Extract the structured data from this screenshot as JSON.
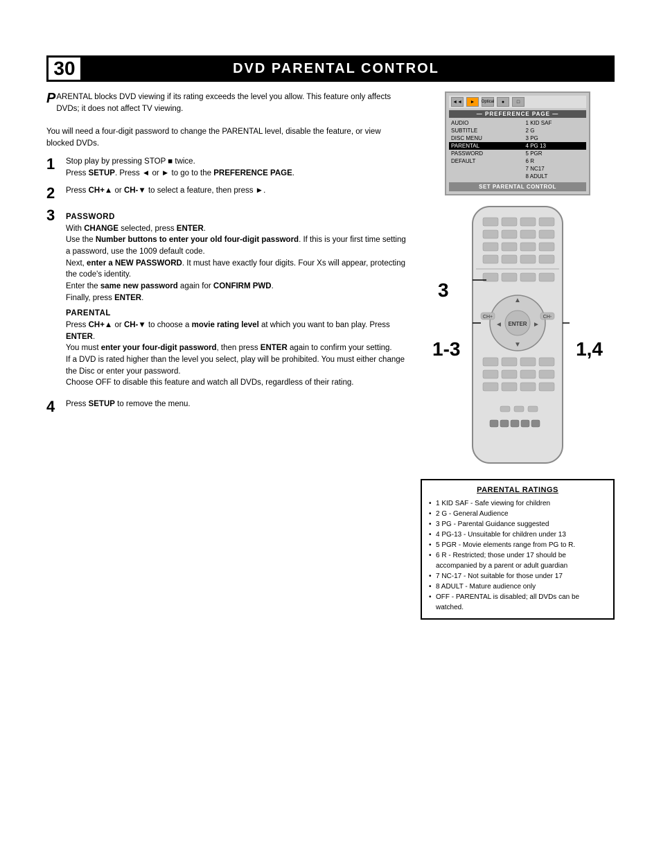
{
  "header": {
    "page_number": "30",
    "title": "DVD Parental Control"
  },
  "intro": {
    "drop_letter": "P",
    "text": "ARENTAL blocks DVD viewing if its rating exceeds the level you allow. This feature only affects DVDs; it does not affect TV viewing.",
    "note": "You will need a four-digit password to change the PARENTAL level, disable the feature, or view blocked DVDs."
  },
  "steps": [
    {
      "number": "1",
      "lines": [
        "Stop play by pressing STOP ■ twice.",
        "Press SETUP. Press ◄ or ► to go to the PREFERENCE PAGE."
      ]
    },
    {
      "number": "2",
      "lines": [
        "Press CH+▲ or CH-▼ to select a feature, then press ►."
      ]
    },
    {
      "number": "3",
      "sub_title": "PASSWORD",
      "lines": [
        "With CHANGE selected, press ENTER.",
        "Use the Number buttons to enter your old four-digit password. If this is your first time setting a password, use the 1009 default code.",
        "Next, enter a NEW PASSWORD. It must have exactly four digits. Four Xs will appear, protecting the code's identity.",
        "Enter the same new password again for CONFIRM PWD.",
        "Finally, press ENTER."
      ],
      "parental_sub": {
        "title": "PARENTAL",
        "lines": [
          "Press CH+▲ or CH-▼ to choose a movie rating level at which you want to ban play. Press ENTER.",
          "You must enter your four-digit password, then press ENTER again to confirm your setting.",
          "If a DVD is rated higher than the level you select, play will be prohibited. You must either change the Disc or enter your password.",
          "Choose OFF to disable this feature and watch all DVDs, regardless of their rating."
        ]
      }
    },
    {
      "number": "4",
      "lines": [
        "Press SETUP to remove the menu."
      ]
    }
  ],
  "tv_screen": {
    "pref_page_label": "— PREFERENCE PAGE —",
    "rows": [
      {
        "label": "AUDIO",
        "value": "1 KID SAF",
        "highlighted": false
      },
      {
        "label": "SUBTITLE",
        "value": "2 G",
        "highlighted": false
      },
      {
        "label": "DISC MENU",
        "value": "3 PG",
        "highlighted": false
      },
      {
        "label": "PARENTAL",
        "value": "4 PG 13",
        "highlighted": true
      },
      {
        "label": "PASSWORD",
        "value": "5 PGR",
        "highlighted": false
      },
      {
        "label": "DEFAULT",
        "value": "6 R",
        "highlighted": false
      },
      {
        "label": "",
        "value": "7 NC17",
        "highlighted": false
      },
      {
        "label": "",
        "value": "8 ADULT",
        "highlighted": false
      }
    ],
    "set_button": "SET PARENTAL CONTROL"
  },
  "step_labels": {
    "label_3": "3",
    "label_13": "1-3",
    "label_14": "1,4"
  },
  "ratings_box": {
    "title": "Parental Ratings",
    "items": [
      "1 KID SAF - Safe viewing for children",
      "2 G - General Audience",
      "3 PG - Parental Guidance suggested",
      "4 PG-13 - Unsuitable for children under 13",
      "5 PGR - Movie elements range from PG to R.",
      "6 R - Restricted; those under 17 should be accompanied by a parent or adult guardian",
      "7 NC-17 - Not suitable for those under 17",
      "8 ADULT - Mature audience only",
      "OFF - PARENTAL is disabled; all DVDs can be watched."
    ]
  }
}
